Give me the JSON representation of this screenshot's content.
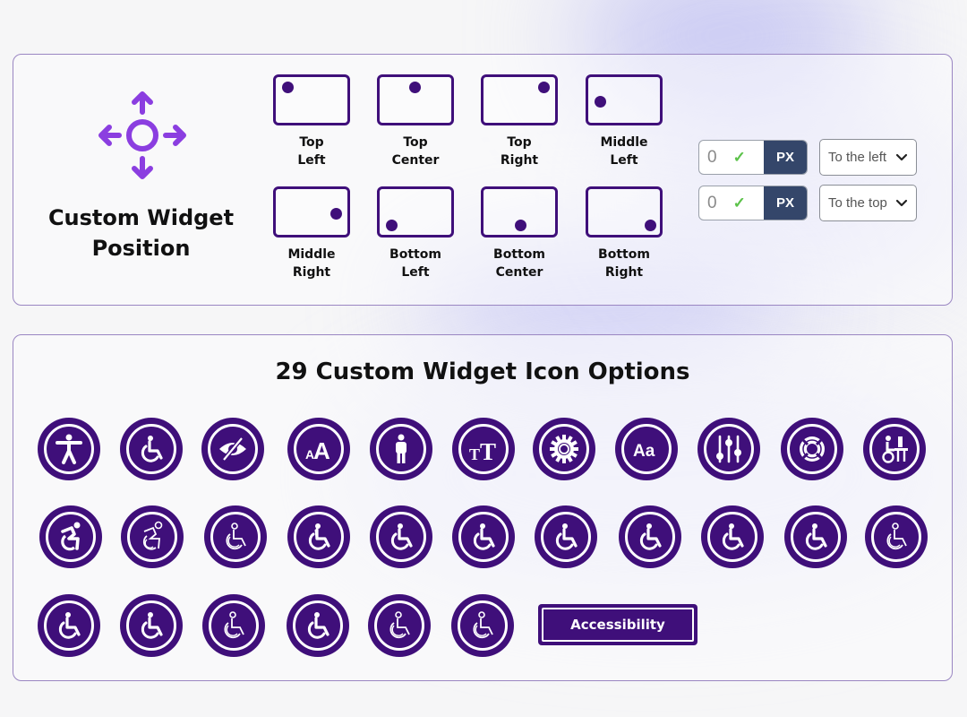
{
  "colors": {
    "accent_purple": "#3f0f7a",
    "move_icon_purple": "#8b3ee0",
    "unit_navy": "#34466a",
    "check_green": "#5cc24a",
    "panel_border": "#9a86c2"
  },
  "position_panel": {
    "icon": "move-arrows-icon",
    "title": "Custom Widget Position",
    "positions": [
      {
        "label_line1": "Top",
        "label_line2": "Left"
      },
      {
        "label_line1": "Top",
        "label_line2": "Center"
      },
      {
        "label_line1": "Top",
        "label_line2": "Right"
      },
      {
        "label_line1": "Middle",
        "label_line2": "Left"
      },
      {
        "label_line1": "Middle",
        "label_line2": "Right"
      },
      {
        "label_line1": "Bottom",
        "label_line2": "Left"
      },
      {
        "label_line1": "Bottom",
        "label_line2": "Center"
      },
      {
        "label_line1": "Bottom",
        "label_line2": "Right"
      }
    ],
    "offsets": [
      {
        "value": "0",
        "unit": "PX",
        "direction": "To the left"
      },
      {
        "value": "0",
        "unit": "PX",
        "direction": "To the top"
      }
    ]
  },
  "icons_panel": {
    "title": "29 Custom Widget Icon Options",
    "icons": [
      "accessibility-person-icon",
      "wheelchair-icon",
      "eye-slash-icon",
      "font-size-icon",
      "person-standing-icon",
      "text-height-icon",
      "gear-icon",
      "aa-text-icon",
      "sliders-icon",
      "lifebuoy-icon",
      "wheelchair-desk-icon",
      "active-wheelchair-icon",
      "active-wheelchair-outline-icon",
      "wheelchair-outline-icon",
      "wheelchair-variant-1-icon",
      "wheelchair-variant-2-icon",
      "wheelchair-variant-3-icon",
      "wheelchair-variant-4-icon",
      "wheelchair-variant-5-icon",
      "wheelchair-variant-6-icon",
      "wheelchair-variant-7-icon",
      "wheelchair-variant-8-icon",
      "wheelchair-variant-9-icon",
      "wheelchair-variant-10-icon",
      "wheelchair-variant-11-icon",
      "wheelchair-variant-12-icon",
      "wheelchair-variant-13-icon",
      "wheelchair-variant-14-icon"
    ],
    "text_button_label": "Accessibility"
  }
}
